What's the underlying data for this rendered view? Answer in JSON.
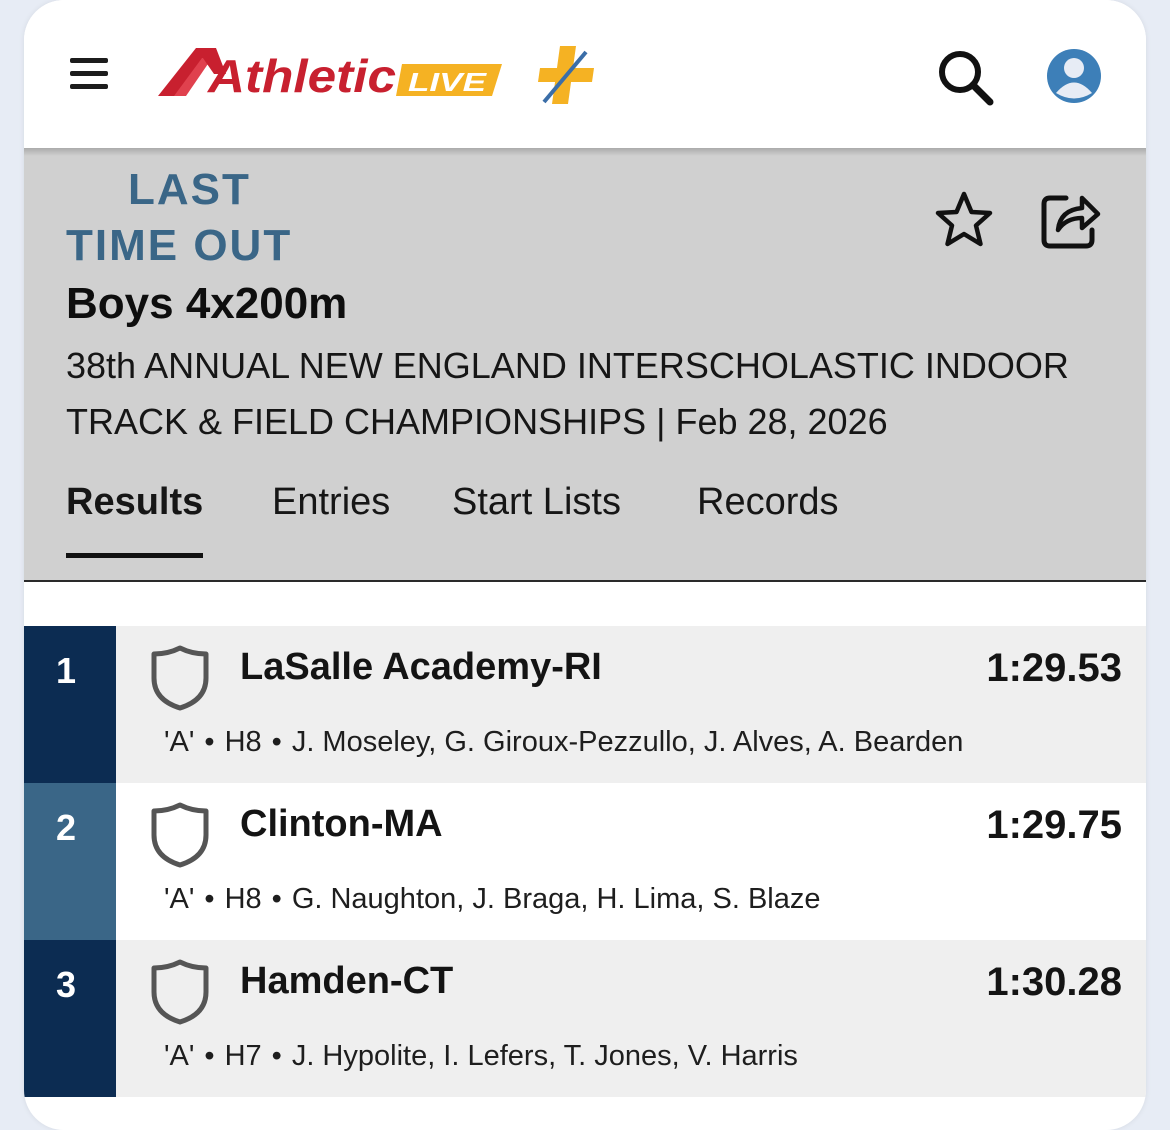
{
  "app": {
    "logo_text": "Athletic",
    "logo_badge": "LIVE",
    "colors": {
      "logo_red": "#c8202f",
      "logo_yellow": "#f5b223",
      "logo_blue": "#3b6ea8",
      "avatar_blue": "#3d7fb8"
    }
  },
  "header": {
    "meet_logo_line1": "LAST",
    "meet_logo_line2": "TIME OUT",
    "event_title": "Boys 4x200m",
    "meet_name": "38th ANNUAL NEW ENGLAND INTERSCHOLASTIC INDOOR TRACK & FIELD CHAMPIONSHIPS | Feb 28, 2026",
    "background": "#d0d0d0",
    "meet_logo_color": "#3a6687"
  },
  "tabs": [
    {
      "label": "Results",
      "active": true
    },
    {
      "label": "Entries",
      "active": false
    },
    {
      "label": "Start Lists",
      "active": false
    },
    {
      "label": "Records",
      "active": false
    }
  ],
  "results": [
    {
      "place": "1",
      "team": "LaSalle Academy-RI",
      "time": "1:29.53",
      "relay": "'A'",
      "heat": "H8",
      "athletes": "J. Moseley, G. Giroux-Pezzullo, J. Alves, A. Bearden",
      "place_color": "#0c2c52",
      "row_bg": "#efefef"
    },
    {
      "place": "2",
      "team": "Clinton-MA",
      "time": "1:29.75",
      "relay": "'A'",
      "heat": "H8",
      "athletes": "G. Naughton, J. Braga, H. Lima, S. Blaze",
      "place_color": "#3a6687",
      "row_bg": "#ffffff"
    },
    {
      "place": "3",
      "team": "Hamden-CT",
      "time": "1:30.28",
      "relay": "'A'",
      "heat": "H7",
      "athletes": "J. Hypolite, I. Lefers, T. Jones, V. Harris",
      "place_color": "#0c2c52",
      "row_bg": "#efefef"
    }
  ]
}
